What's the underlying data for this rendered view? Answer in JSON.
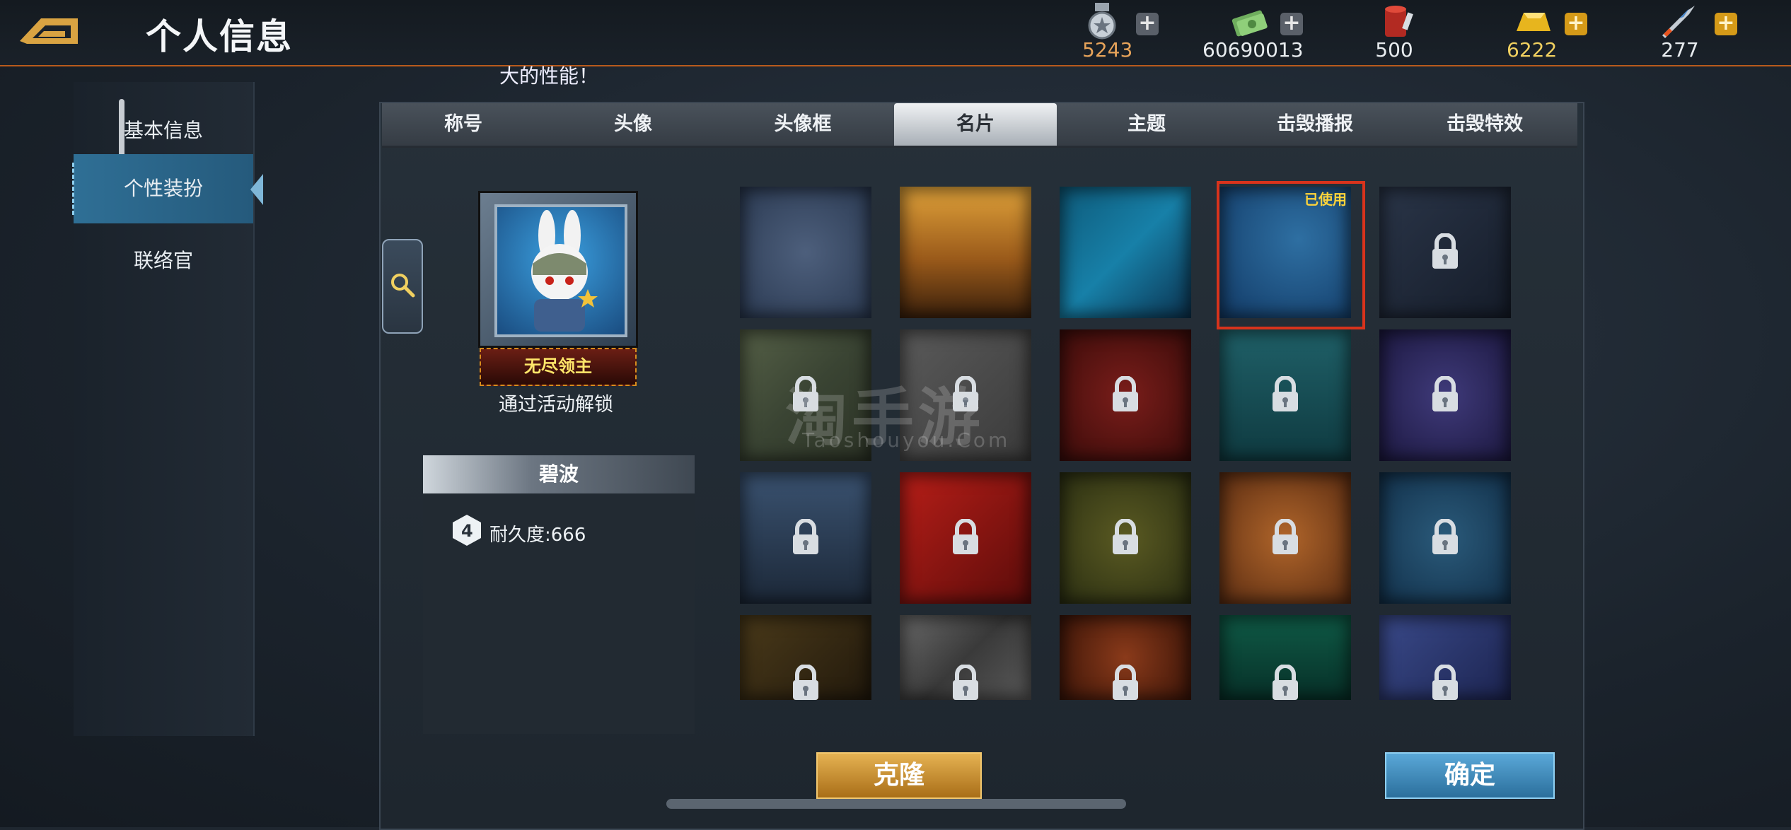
{
  "header": {
    "title": "个人信息",
    "resources": [
      {
        "icon": "medal-icon",
        "value": "5243",
        "color": "#e6a35a",
        "plus": "+"
      },
      {
        "icon": "cash-icon",
        "value": "60690013",
        "color": "#e8ecef",
        "plus": "+"
      },
      {
        "icon": "paint-bucket-icon",
        "value": "500",
        "color": "#e8ecef"
      },
      {
        "icon": "gold-bar-icon",
        "value": "6222",
        "color": "#f0d060",
        "plus": "+"
      },
      {
        "icon": "rocket-icon",
        "value": "277",
        "color": "#e8ecef",
        "plus": "+"
      }
    ]
  },
  "ticker": "大的性能！",
  "sidebar": {
    "items": [
      {
        "label": "基本信息"
      },
      {
        "label": "个性装扮",
        "active": true
      },
      {
        "label": "联络官"
      }
    ]
  },
  "tabs": [
    {
      "label": "称号"
    },
    {
      "label": "头像"
    },
    {
      "label": "头像框"
    },
    {
      "label": "名片",
      "active": true
    },
    {
      "label": "主题"
    },
    {
      "label": "击毁播报"
    },
    {
      "label": "击毁特效"
    }
  ],
  "preview": {
    "nameplate": "无尽领主",
    "unlock_hint": "通过活动解锁",
    "card_name": "碧波",
    "durability": "耐久度:666"
  },
  "grid": {
    "used_label": "已使用",
    "cards": [
      {
        "name": "honeycomb-blue",
        "locked": false
      },
      {
        "name": "desert-sunset",
        "locked": false
      },
      {
        "name": "hex-tech",
        "locked": false
      },
      {
        "name": "bubbles",
        "locked": false,
        "used": true
      },
      {
        "name": "star-dark",
        "locked": true
      },
      {
        "name": "camo-green",
        "locked": true
      },
      {
        "name": "grey-x",
        "locked": true
      },
      {
        "name": "crimson",
        "locked": true
      },
      {
        "name": "teal-sea",
        "locked": true
      },
      {
        "name": "purple-night",
        "locked": true
      },
      {
        "name": "helicopter-night",
        "locked": true
      },
      {
        "name": "red-star-flag",
        "locked": true
      },
      {
        "name": "floral-olive",
        "locked": true
      },
      {
        "name": "autumn-leaves",
        "locked": true
      },
      {
        "name": "blue-floral",
        "locked": true
      },
      {
        "name": "gold-star",
        "locked": true
      },
      {
        "name": "silver-stripe",
        "locked": true
      },
      {
        "name": "red-pattern",
        "locked": true
      },
      {
        "name": "green-deep",
        "locked": true
      },
      {
        "name": "indigo-stripe",
        "locked": true
      }
    ]
  },
  "watermark": {
    "main": "淘手游",
    "sub": "Taoshouyou.Com"
  },
  "buttons": {
    "clone": "克隆",
    "confirm": "确定"
  }
}
